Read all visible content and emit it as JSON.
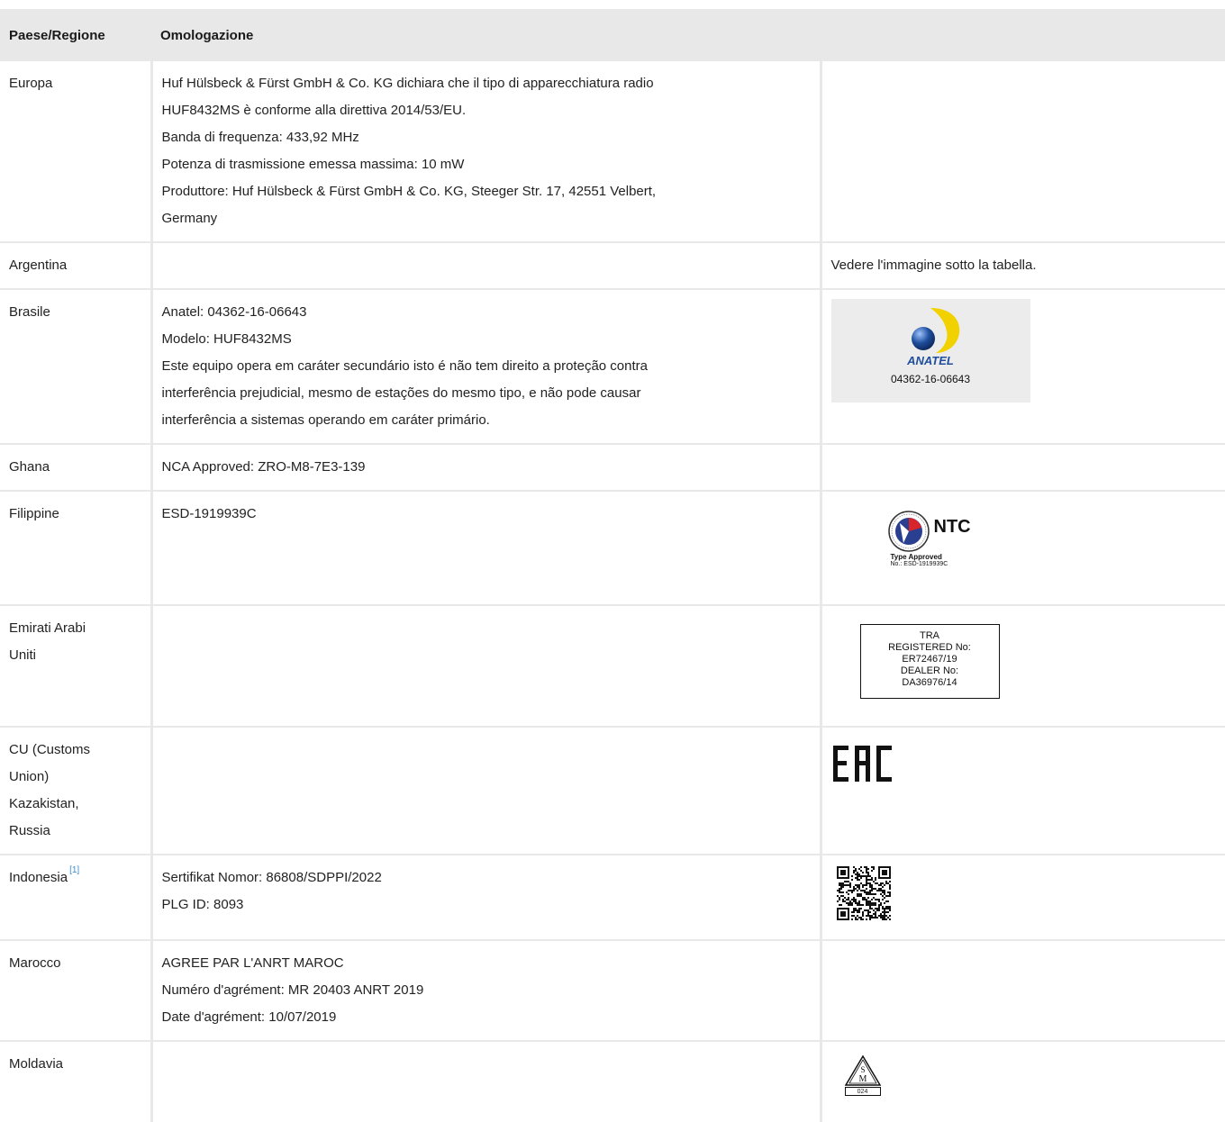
{
  "table": {
    "headers": [
      "Paese/Regione",
      "Omologazione"
    ],
    "rows": [
      {
        "country": "Europa",
        "lines": [
          "Huf Hülsbeck & Fürst GmbH & Co. KG dichiara che il tipo di apparecchiatura radio",
          "HUF8432MS è conforme alla direttiva 2014/53/EU.",
          "Banda di frequenza: 433,92 MHz",
          "Potenza di trasmissione emessa massima: 10 mW",
          "Produttore: Huf Hülsbeck & Fürst GmbH & Co. KG, Steeger Str. 17, 42551 Velbert,",
          "Germany"
        ]
      },
      {
        "country": "Argentina",
        "note": "Vedere l'immagine sotto la tabella."
      },
      {
        "country": "Brasile",
        "lines": [
          "Anatel: 04362-16-06643",
          "Modelo: HUF8432MS",
          "Este equipo opera em caráter secundário isto é não tem direito a proteção contra",
          "interferência prejudicial, mesmo de estações do mesmo tipo, e não pode causar",
          "interferência a sistemas operando em caráter primário."
        ],
        "logo": {
          "icon": "anatel-logo",
          "word": "ANATEL",
          "number": "04362-16-06643"
        }
      },
      {
        "country": "Ghana",
        "lines": [
          "NCA Approved: ZRO-M8-7E3-139"
        ]
      },
      {
        "country": "Filippine",
        "lines": [
          "ESD-1919939C"
        ],
        "logo": {
          "icon": "ntc-logo",
          "name": "NTC",
          "type_approved": "Type Approved",
          "number": "No.: ESD-1919939C"
        }
      },
      {
        "country_lines": [
          "Emirati Arabi",
          "Uniti"
        ],
        "logo": {
          "icon": "tra-label",
          "lines": [
            "TRA",
            "REGISTERED No:",
            "ER72467/19",
            "DEALER No:",
            "DA36976/14"
          ]
        }
      },
      {
        "country_lines": [
          "CU (Customs",
          "Union)",
          "Kazakistan,",
          "Russia"
        ],
        "logo": {
          "icon": "eac-logo"
        }
      },
      {
        "country": "Indonesia",
        "footnote": "[1]",
        "lines": [
          "Sertifikat Nomor: 86808/SDPPI/2022",
          "PLG ID: 8093"
        ],
        "logo": {
          "icon": "qr-code"
        }
      },
      {
        "country": "Marocco",
        "lines": [
          "AGREE PAR L'ANRT MAROC",
          "Numéro d'agrément: MR 20403 ANRT 2019",
          "Date d'agrément: 10/07/2019"
        ]
      },
      {
        "country": "Moldavia",
        "logo": {
          "icon": "sm-moldova-mark",
          "number": "024"
        }
      }
    ]
  },
  "colors": {
    "header_bg": "#e8e8e8",
    "border": "#e8e8e8",
    "footnote": "#3a8fd0",
    "anatel_blue": "#1e4e9c",
    "anatel_yellow": "#f2d100"
  }
}
